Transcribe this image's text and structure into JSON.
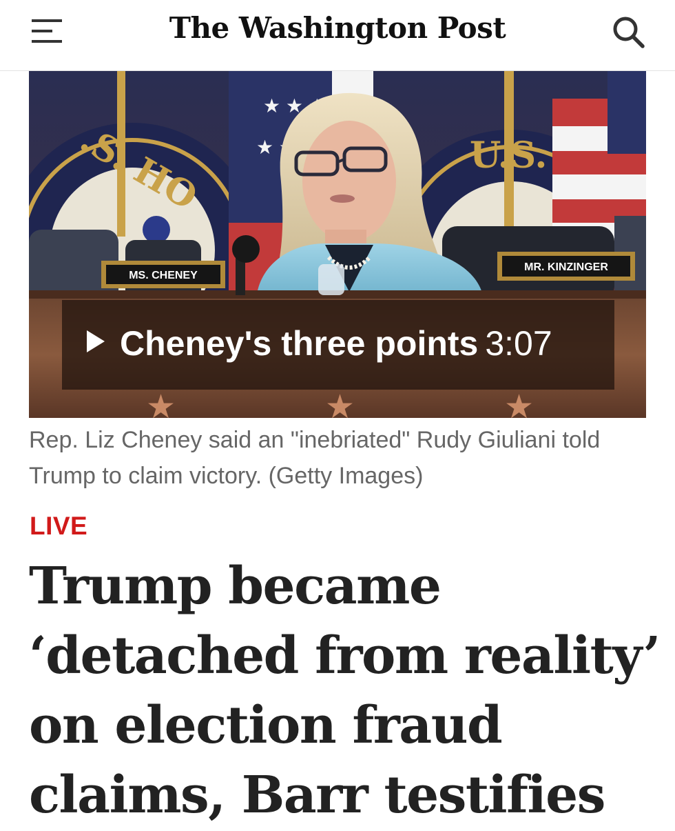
{
  "header": {
    "masthead": "The Washington Post"
  },
  "media": {
    "nameplates": {
      "left": "MS. CHENEY",
      "right": "MR. KINZINGER"
    },
    "seal_left_text": ".S. HO",
    "seal_right_text": "U.S.",
    "video": {
      "title": "Cheney's three points",
      "duration": "3:07"
    }
  },
  "caption": "Rep. Liz Cheney said an \"inebriated\" Rudy Giuliani told Trump to claim victory. (Getty Images)",
  "live_label": "LIVE",
  "headline": "Trump became ‘detached from reality’ on election fraud claims, Barr testifies",
  "icons": {
    "menu": "hamburger-menu-icon",
    "search": "search-icon",
    "play": "play-icon"
  },
  "colors": {
    "live_red": "#d11a1a",
    "caption_gray": "#666666",
    "headline": "#222222"
  }
}
